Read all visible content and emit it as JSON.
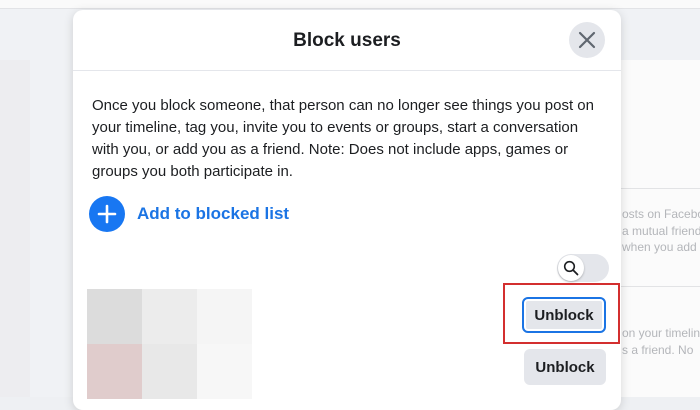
{
  "dialog": {
    "title": "Block users",
    "description": "Once you block someone, that person can no longer see things you post on your timeline, tag you, invite you to events or groups, start a conversation with you, or add you as a friend. Note: Does not include apps, games or groups you both participate in.",
    "add_label": "Add to blocked list",
    "blocked_users": [
      {
        "unblock_label": "Unblock"
      },
      {
        "unblock_label": "Unblock"
      }
    ]
  },
  "background": {
    "snippets": [
      "osts on Faceboo",
      "a mutual friend",
      "when you add",
      "on your timelin",
      "s a friend. No"
    ]
  },
  "colors": {
    "accent": "#1877f2",
    "accent_text": "#1b74e4",
    "highlight": "#d32f2f",
    "button_bg": "#e4e6eb"
  },
  "icons": {
    "close": "close-icon",
    "add": "plus-icon",
    "search": "search-icon"
  }
}
